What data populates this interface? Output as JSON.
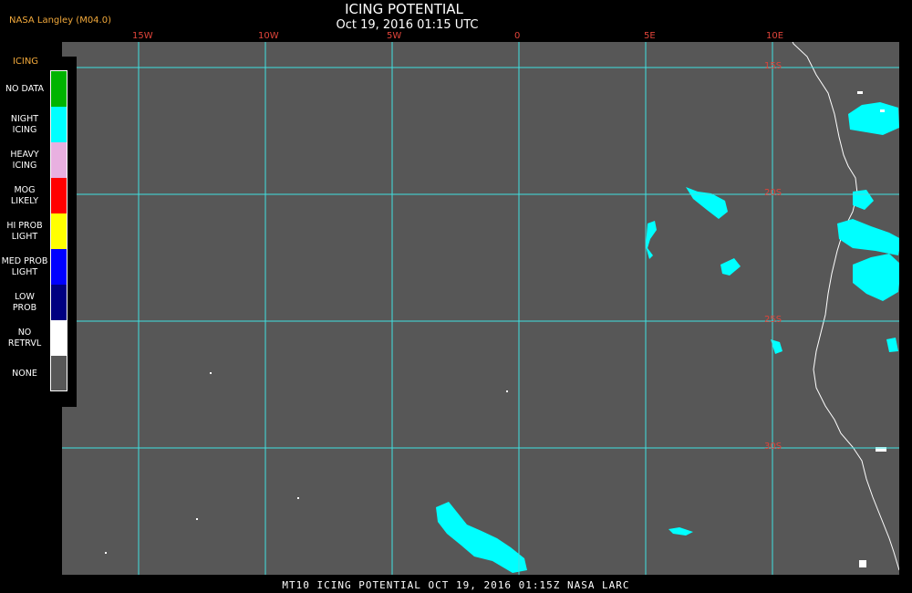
{
  "credit": "NASA Langley (M04.0)",
  "title": "ICING POTENTIAL",
  "subtitle": "Oct 19, 2016 01:15 UTC",
  "footer": "MT10  ICING POTENTIAL  OCT 19, 2016 01:15Z  NASA LARC",
  "map": {
    "background": "#575757",
    "grid_color": "#3fe0e0",
    "label_color": "#e0443a",
    "longitude_labels": [
      "15W",
      "10W",
      "5W",
      "0",
      "5E",
      "10E"
    ],
    "latitude_labels": [
      "15S",
      "20S",
      "25S",
      "30S"
    ]
  },
  "legend": {
    "title": "ICING",
    "entries": [
      {
        "label": "NO DATA",
        "color": "#00b400"
      },
      {
        "label": "NIGHT\nICING",
        "color": "#00ffff"
      },
      {
        "label": "HEAVY\nICING",
        "color": "#e8b0e0"
      },
      {
        "label": "MOG\nLIKELY",
        "color": "#ff0000"
      },
      {
        "label": "HI PROB\nLIGHT",
        "color": "#ffff00"
      },
      {
        "label": "MED PROB\nLIGHT",
        "color": "#0000ff"
      },
      {
        "label": "LOW\nPROB",
        "color": "#000080"
      },
      {
        "label": "NO\nRETRVL",
        "color": "#ffffff"
      },
      {
        "label": "NONE",
        "color": "#575757"
      }
    ]
  }
}
